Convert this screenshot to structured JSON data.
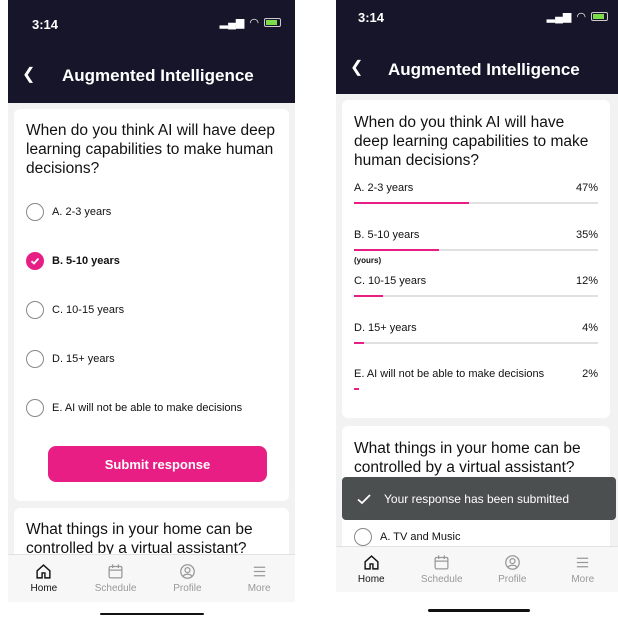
{
  "status": {
    "time": "3:14"
  },
  "header": {
    "title": "Augmented Intelligence"
  },
  "poll": {
    "question": "When do you think AI will have deep learning capabilities to make human decisions?",
    "options": [
      {
        "label": "A.  2-3 years",
        "selected": false
      },
      {
        "label": "B.  5-10 years",
        "selected": true
      },
      {
        "label": "C.  10-15 years",
        "selected": false
      },
      {
        "label": "D.  15+ years",
        "selected": false
      },
      {
        "label": "E.  AI will not be able to make decisions",
        "selected": false
      }
    ],
    "submit_label": "Submit response"
  },
  "results": [
    {
      "label": "A. 2-3 years",
      "percent_label": "47%",
      "percent": 47
    },
    {
      "label": "B. 5-10 years",
      "percent_label": "35%",
      "percent": 35,
      "note": "(yours)"
    },
    {
      "label": "C. 10-15 years",
      "percent_label": "12%",
      "percent": 12
    },
    {
      "label": "D. 15+ years",
      "percent_label": "4%",
      "percent": 4
    },
    {
      "label": "E. AI will not be able to make decisions",
      "percent_label": "2%",
      "percent": 2
    }
  ],
  "next_question": "What things in your home can be controlled by a virtual assistant?",
  "next_option": "A.  TV and Music",
  "toast": "Your response has been submitted",
  "tabs": [
    {
      "label": "Home",
      "icon": "home-icon",
      "active": true
    },
    {
      "label": "Schedule",
      "icon": "calendar-icon",
      "active": false
    },
    {
      "label": "Profile",
      "icon": "profile-icon",
      "active": false
    },
    {
      "label": "More",
      "icon": "menu-icon",
      "active": false
    }
  ],
  "colors": {
    "accent": "#e91e84",
    "header_bg": "#16152a",
    "toast_bg": "#4c4f4f"
  }
}
